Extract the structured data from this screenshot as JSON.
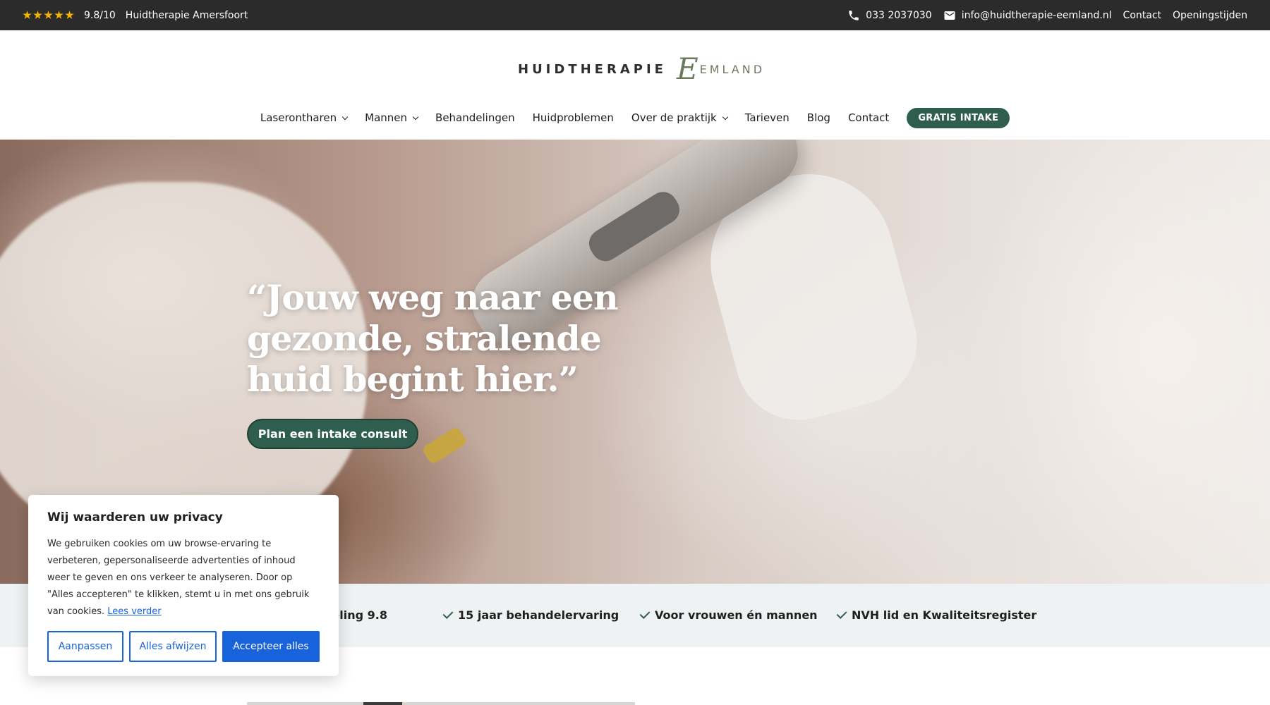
{
  "topbar": {
    "rating": "9.8/10",
    "location": "Huidtherapie Amersfoort",
    "phone": "033 2037030",
    "email": "info@huidtherapie-eemland.nl",
    "contact": "Contact",
    "hours": "Openingstijden"
  },
  "logo": {
    "part1": "HUIDTHERAPIE",
    "e": "E",
    "part2": "EMLAND"
  },
  "nav": {
    "laserontharen": "Laserontharen",
    "mannen": "Mannen",
    "behandelingen": "Behandelingen",
    "huidproblemen": "Huidproblemen",
    "over": "Over de praktijk",
    "tarieven": "Tarieven",
    "blog": "Blog",
    "contact": "Contact",
    "cta": "GRATIS INTAKE"
  },
  "hero": {
    "title": "“Jouw weg naar een gezonde, stralende huid begint hier.”",
    "button": "Plan een intake consult"
  },
  "usp": {
    "item1": "Beoordeling 9.8",
    "item2": "15 jaar behandelervaring",
    "item3": "Voor vrouwen én mannen",
    "item4": "NVH lid en Kwaliteitsregister"
  },
  "cookie": {
    "title": "Wij waarderen uw privacy",
    "text": "We gebruiken cookies om uw browse-ervaring te verbeteren, gepersonaliseerde advertenties of inhoud weer te geven en ons verkeer te analyseren. Door op \"Alles accepteren\" te klikken, stemt u in met ons gebruik van cookies.",
    "link": "Lees verder",
    "customize": "Aanpassen",
    "reject": "Alles afwijzen",
    "accept": "Accepteer alles"
  },
  "colors": {
    "brand_green": "#2f5d4e",
    "topbar": "#2b2b2b",
    "cookie_blue": "#1863dc",
    "star": "#f5b301"
  }
}
